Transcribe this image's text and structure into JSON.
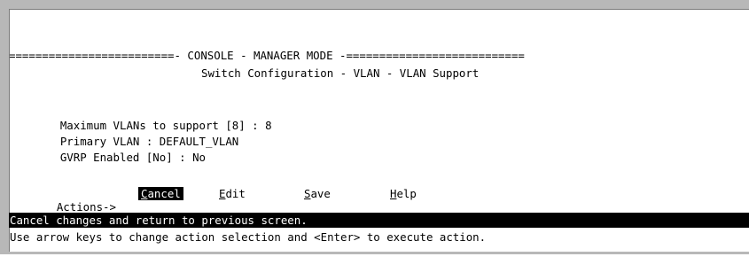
{
  "banner": "=========================- CONSOLE - MANAGER MODE -===========================",
  "screen_title": "Switch Configuration - VLAN - VLAN Support",
  "fields": [
    {
      "label": "Maximum VLANs to support [8] :",
      "value": "8"
    },
    {
      "label": "Primary VLAN :",
      "value": "DEFAULT_VLAN"
    },
    {
      "label": "GVRP Enabled [No] :",
      "value": "No"
    }
  ],
  "actions": {
    "prefix": "Actions->",
    "items": [
      {
        "hotkey": "C",
        "rest": "ancel",
        "selected": true
      },
      {
        "hotkey": "E",
        "rest": "dit",
        "selected": false
      },
      {
        "hotkey": "S",
        "rest": "ave",
        "selected": false
      },
      {
        "hotkey": "H",
        "rest": "elp",
        "selected": false
      }
    ]
  },
  "status_message": "Cancel changes and return to previous screen.",
  "help_text": "Use arrow keys to change action selection and <Enter> to execute action.",
  "colors": {
    "window_frame": "#b8b8b8",
    "highlight_bg": "#000000",
    "highlight_fg": "#ffffff"
  }
}
